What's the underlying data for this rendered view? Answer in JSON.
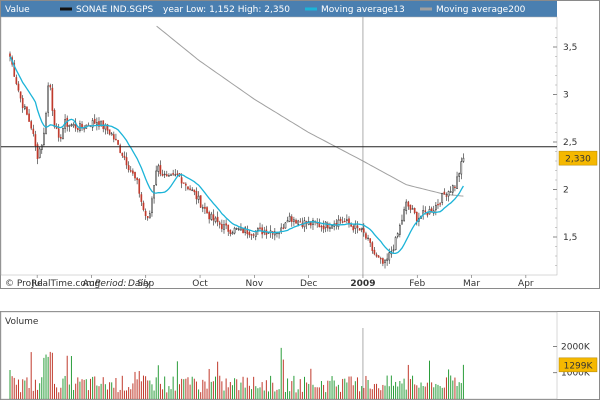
{
  "header": {
    "value_label": "Value",
    "ticker": "SONAE IND.SGPS",
    "range_text": "year Low: 1,152 High: 2,350",
    "ma13_label": "Moving average13",
    "ma200_label": "Moving average200"
  },
  "footer": {
    "source": "© ProRealTime.com",
    "period_label": "Period:",
    "period_value": "Daily"
  },
  "volume_panel": {
    "title": "Volume"
  },
  "colors": {
    "header_bg": "#4a7fb0",
    "ma13": "#1cb4d8",
    "ma200": "#a0a0a0",
    "up": "#2a9d3a",
    "down": "#c0392b",
    "price_tag": "#f5b800"
  },
  "chart_data": [
    {
      "type": "candlestick",
      "title": "SONAE IND.SGPS",
      "months": [
        "Jul",
        "Aug",
        "Sep",
        "Oct",
        "Nov",
        "Dec",
        "2009",
        "Feb",
        "Mar",
        "Apr"
      ],
      "y_ticks": [
        "3,5",
        "3",
        "2,5",
        "2",
        "1,5"
      ],
      "y_tick_values": [
        3.5,
        3.0,
        2.5,
        2.0,
        1.5
      ],
      "ylim": [
        1.05,
        3.85
      ],
      "last_price": "2,330",
      "last_value": 2.33,
      "hline_value": 2.45,
      "price_anchors": [
        {
          "m": 0.0,
          "v": 3.4
        },
        {
          "m": 0.2,
          "v": 2.95
        },
        {
          "m": 0.4,
          "v": 2.65
        },
        {
          "m": 0.5,
          "v": 2.35
        },
        {
          "m": 0.62,
          "v": 2.55
        },
        {
          "m": 0.72,
          "v": 3.2
        },
        {
          "m": 0.8,
          "v": 2.75
        },
        {
          "m": 0.9,
          "v": 2.5
        },
        {
          "m": 1.0,
          "v": 2.7
        },
        {
          "m": 1.3,
          "v": 2.65
        },
        {
          "m": 1.6,
          "v": 2.72
        },
        {
          "m": 1.85,
          "v": 2.6
        },
        {
          "m": 2.1,
          "v": 2.35
        },
        {
          "m": 2.35,
          "v": 2.05
        },
        {
          "m": 2.45,
          "v": 1.8
        },
        {
          "m": 2.55,
          "v": 1.65
        },
        {
          "m": 2.7,
          "v": 2.25
        },
        {
          "m": 2.9,
          "v": 2.1
        },
        {
          "m": 3.1,
          "v": 2.15
        },
        {
          "m": 3.4,
          "v": 1.95
        },
        {
          "m": 3.7,
          "v": 1.7
        },
        {
          "m": 4.0,
          "v": 1.58
        },
        {
          "m": 4.5,
          "v": 1.56
        },
        {
          "m": 5.0,
          "v": 1.57
        },
        {
          "m": 5.1,
          "v": 1.72
        },
        {
          "m": 5.4,
          "v": 1.65
        },
        {
          "m": 5.8,
          "v": 1.62
        },
        {
          "m": 6.1,
          "v": 1.68
        },
        {
          "m": 6.5,
          "v": 1.55
        },
        {
          "m": 6.75,
          "v": 1.28
        },
        {
          "m": 6.9,
          "v": 1.2
        },
        {
          "m": 7.1,
          "v": 1.45
        },
        {
          "m": 7.3,
          "v": 1.85
        },
        {
          "m": 7.5,
          "v": 1.7
        },
        {
          "m": 7.8,
          "v": 1.8
        },
        {
          "m": 8.0,
          "v": 1.95
        },
        {
          "m": 8.2,
          "v": 2.05
        },
        {
          "m": 8.35,
          "v": 2.33
        }
      ],
      "ma200_anchors": [
        {
          "m": 2.7,
          "v": 3.72
        },
        {
          "m": 3.5,
          "v": 3.35
        },
        {
          "m": 4.5,
          "v": 2.95
        },
        {
          "m": 5.5,
          "v": 2.6
        },
        {
          "m": 6.5,
          "v": 2.3
        },
        {
          "m": 7.3,
          "v": 2.05
        },
        {
          "m": 8.0,
          "v": 1.95
        },
        {
          "m": 8.35,
          "v": 1.93
        }
      ],
      "candle_count": 215
    },
    {
      "type": "bar",
      "title": "Volume",
      "y_ticks": [
        "2000K",
        "1000K"
      ],
      "y_tick_values": [
        2000,
        1000
      ],
      "ylim": [
        0,
        2700
      ],
      "unit": "K",
      "last_volume": "1299K",
      "last_volume_value": 1299
    }
  ]
}
